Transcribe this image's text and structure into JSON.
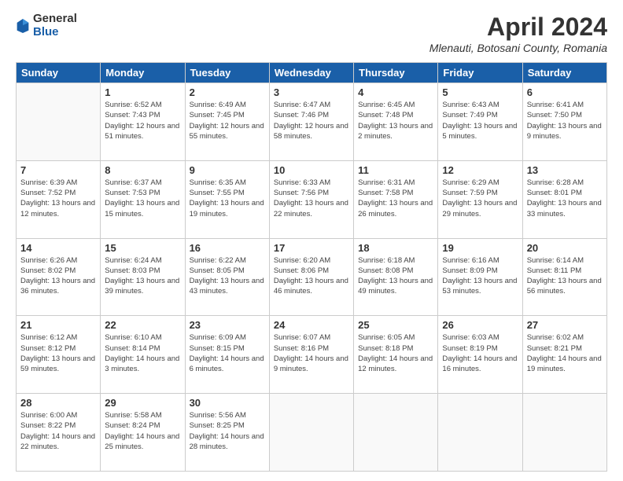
{
  "header": {
    "logo_general": "General",
    "logo_blue": "Blue",
    "month_year": "April 2024",
    "location": "Mlenauti, Botosani County, Romania"
  },
  "days_of_week": [
    "Sunday",
    "Monday",
    "Tuesday",
    "Wednesday",
    "Thursday",
    "Friday",
    "Saturday"
  ],
  "weeks": [
    [
      {
        "day": "",
        "info": ""
      },
      {
        "day": "1",
        "info": "Sunrise: 6:52 AM\nSunset: 7:43 PM\nDaylight: 12 hours\nand 51 minutes."
      },
      {
        "day": "2",
        "info": "Sunrise: 6:49 AM\nSunset: 7:45 PM\nDaylight: 12 hours\nand 55 minutes."
      },
      {
        "day": "3",
        "info": "Sunrise: 6:47 AM\nSunset: 7:46 PM\nDaylight: 12 hours\nand 58 minutes."
      },
      {
        "day": "4",
        "info": "Sunrise: 6:45 AM\nSunset: 7:48 PM\nDaylight: 13 hours\nand 2 minutes."
      },
      {
        "day": "5",
        "info": "Sunrise: 6:43 AM\nSunset: 7:49 PM\nDaylight: 13 hours\nand 5 minutes."
      },
      {
        "day": "6",
        "info": "Sunrise: 6:41 AM\nSunset: 7:50 PM\nDaylight: 13 hours\nand 9 minutes."
      }
    ],
    [
      {
        "day": "7",
        "info": "Sunrise: 6:39 AM\nSunset: 7:52 PM\nDaylight: 13 hours\nand 12 minutes."
      },
      {
        "day": "8",
        "info": "Sunrise: 6:37 AM\nSunset: 7:53 PM\nDaylight: 13 hours\nand 15 minutes."
      },
      {
        "day": "9",
        "info": "Sunrise: 6:35 AM\nSunset: 7:55 PM\nDaylight: 13 hours\nand 19 minutes."
      },
      {
        "day": "10",
        "info": "Sunrise: 6:33 AM\nSunset: 7:56 PM\nDaylight: 13 hours\nand 22 minutes."
      },
      {
        "day": "11",
        "info": "Sunrise: 6:31 AM\nSunset: 7:58 PM\nDaylight: 13 hours\nand 26 minutes."
      },
      {
        "day": "12",
        "info": "Sunrise: 6:29 AM\nSunset: 7:59 PM\nDaylight: 13 hours\nand 29 minutes."
      },
      {
        "day": "13",
        "info": "Sunrise: 6:28 AM\nSunset: 8:01 PM\nDaylight: 13 hours\nand 33 minutes."
      }
    ],
    [
      {
        "day": "14",
        "info": "Sunrise: 6:26 AM\nSunset: 8:02 PM\nDaylight: 13 hours\nand 36 minutes."
      },
      {
        "day": "15",
        "info": "Sunrise: 6:24 AM\nSunset: 8:03 PM\nDaylight: 13 hours\nand 39 minutes."
      },
      {
        "day": "16",
        "info": "Sunrise: 6:22 AM\nSunset: 8:05 PM\nDaylight: 13 hours\nand 43 minutes."
      },
      {
        "day": "17",
        "info": "Sunrise: 6:20 AM\nSunset: 8:06 PM\nDaylight: 13 hours\nand 46 minutes."
      },
      {
        "day": "18",
        "info": "Sunrise: 6:18 AM\nSunset: 8:08 PM\nDaylight: 13 hours\nand 49 minutes."
      },
      {
        "day": "19",
        "info": "Sunrise: 6:16 AM\nSunset: 8:09 PM\nDaylight: 13 hours\nand 53 minutes."
      },
      {
        "day": "20",
        "info": "Sunrise: 6:14 AM\nSunset: 8:11 PM\nDaylight: 13 hours\nand 56 minutes."
      }
    ],
    [
      {
        "day": "21",
        "info": "Sunrise: 6:12 AM\nSunset: 8:12 PM\nDaylight: 13 hours\nand 59 minutes."
      },
      {
        "day": "22",
        "info": "Sunrise: 6:10 AM\nSunset: 8:14 PM\nDaylight: 14 hours\nand 3 minutes."
      },
      {
        "day": "23",
        "info": "Sunrise: 6:09 AM\nSunset: 8:15 PM\nDaylight: 14 hours\nand 6 minutes."
      },
      {
        "day": "24",
        "info": "Sunrise: 6:07 AM\nSunset: 8:16 PM\nDaylight: 14 hours\nand 9 minutes."
      },
      {
        "day": "25",
        "info": "Sunrise: 6:05 AM\nSunset: 8:18 PM\nDaylight: 14 hours\nand 12 minutes."
      },
      {
        "day": "26",
        "info": "Sunrise: 6:03 AM\nSunset: 8:19 PM\nDaylight: 14 hours\nand 16 minutes."
      },
      {
        "day": "27",
        "info": "Sunrise: 6:02 AM\nSunset: 8:21 PM\nDaylight: 14 hours\nand 19 minutes."
      }
    ],
    [
      {
        "day": "28",
        "info": "Sunrise: 6:00 AM\nSunset: 8:22 PM\nDaylight: 14 hours\nand 22 minutes."
      },
      {
        "day": "29",
        "info": "Sunrise: 5:58 AM\nSunset: 8:24 PM\nDaylight: 14 hours\nand 25 minutes."
      },
      {
        "day": "30",
        "info": "Sunrise: 5:56 AM\nSunset: 8:25 PM\nDaylight: 14 hours\nand 28 minutes."
      },
      {
        "day": "",
        "info": ""
      },
      {
        "day": "",
        "info": ""
      },
      {
        "day": "",
        "info": ""
      },
      {
        "day": "",
        "info": ""
      }
    ]
  ]
}
